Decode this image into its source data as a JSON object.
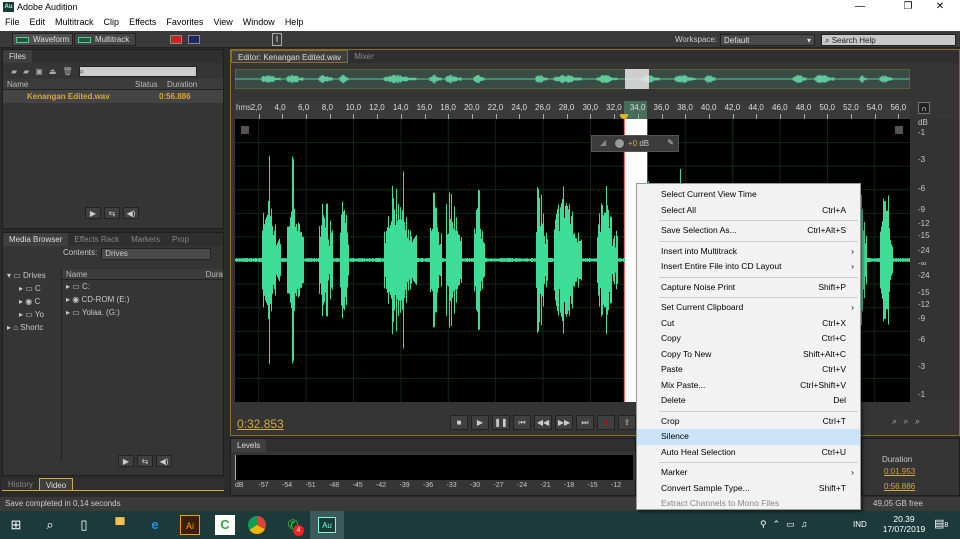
{
  "window": {
    "app_icon": "Au",
    "title": "Adobe Audition",
    "minimize": "—",
    "restore": "❐",
    "close": "✕"
  },
  "menubar": [
    "File",
    "Edit",
    "Multitrack",
    "Clip",
    "Effects",
    "Favorites",
    "View",
    "Window",
    "Help"
  ],
  "toolbar": {
    "waveform": "Waveform",
    "multitrack": "Multitrack",
    "workspace_label": "Workspace:",
    "workspace_value": "Default",
    "search_placeholder": "Search Help"
  },
  "files_panel": {
    "tab": "Files",
    "columns": [
      "Name",
      "Status",
      "Duration"
    ],
    "rows": [
      {
        "name": "Kenangan Edited.wav",
        "status": "",
        "duration": "0:56.886"
      }
    ]
  },
  "media_panel": {
    "tabs": [
      "Media Browser",
      "Effects Rack",
      "Markers",
      "Prop"
    ],
    "contents_label": "Contents:",
    "contents_value": "Drives",
    "tree": [
      "Drives",
      "C",
      "C",
      "Yo",
      "Shortc"
    ],
    "columns": [
      "Name",
      "Dura"
    ],
    "rows": [
      "C:",
      "CD-ROM (E:)",
      "Yolaa. (G:)"
    ]
  },
  "bottom_left_tabs": [
    "History",
    "Video"
  ],
  "editor": {
    "tab": "Editor: Kenangan Edited.wav",
    "mixer_tab": "Mixer",
    "ruler_unit": "hms",
    "ruler_labels": [
      "2,0",
      "4,0",
      "6,0",
      "8,0",
      "10,0",
      "12,0",
      "14,0",
      "16,0",
      "18,0",
      "20,0",
      "22,0",
      "24,0",
      "26,0",
      "28,0",
      "30,0",
      "32,0",
      "34,0",
      "36,0",
      "38,0",
      "40,0",
      "42,0",
      "44,0",
      "46,0",
      "48,0",
      "50,0",
      "52,0",
      "54,0",
      "56,0"
    ],
    "db_labels": [
      "dB",
      "-1",
      "-3",
      "-6",
      "-9",
      "-12",
      "-15",
      "-24",
      "-∞",
      "-24",
      "-15",
      "-12",
      "-9",
      "-6",
      "-3",
      "-1"
    ],
    "hud_value": "+0",
    "hud_unit": "dB",
    "current_time": "0:32.853",
    "duration_s": 56.886,
    "selection_start_s": 32.853,
    "selection_end_s": 34.8
  },
  "transport": [
    "■",
    "▶",
    "❚❚",
    "⏮",
    "◀◀",
    "▶▶",
    "⏭",
    "●",
    "⇪"
  ],
  "levels": {
    "tab": "Levels",
    "scale": [
      "dB",
      "-57",
      "-54",
      "-51",
      "-48",
      "-45",
      "-42",
      "-39",
      "-36",
      "-33",
      "-30",
      "-27",
      "-24",
      "-21",
      "-18",
      "-15",
      "-12"
    ]
  },
  "selection_panel": {
    "duration_header": "Duration",
    "values": [
      "0:01.953",
      "0:56.886"
    ]
  },
  "status": {
    "message": "Save completed in 0,14 seconds",
    "free_space": "49,05 GB free"
  },
  "context_menu": [
    {
      "label": "Select Current View Time",
      "shortcut": ""
    },
    {
      "label": "Select All",
      "shortcut": "Ctrl+A"
    },
    {
      "sep": true
    },
    {
      "label": "Save Selection As...",
      "shortcut": "Ctrl+Alt+S"
    },
    {
      "sep": true
    },
    {
      "label": "Insert into Multitrack",
      "shortcut": "",
      "submenu": true
    },
    {
      "label": "Insert Entire File into CD Layout",
      "shortcut": "",
      "submenu": true
    },
    {
      "sep": true
    },
    {
      "label": "Capture Noise Print",
      "shortcut": "Shift+P"
    },
    {
      "sep": true
    },
    {
      "label": "Set Current Clipboard",
      "shortcut": "",
      "submenu": true
    },
    {
      "label": "Cut",
      "shortcut": "Ctrl+X"
    },
    {
      "label": "Copy",
      "shortcut": "Ctrl+C"
    },
    {
      "label": "Copy To New",
      "shortcut": "Shift+Alt+C"
    },
    {
      "label": "Paste",
      "shortcut": "Ctrl+V"
    },
    {
      "label": "Mix Paste...",
      "shortcut": "Ctrl+Shift+V"
    },
    {
      "label": "Delete",
      "shortcut": "Del"
    },
    {
      "sep": true
    },
    {
      "label": "Crop",
      "shortcut": "Ctrl+T"
    },
    {
      "label": "Silence",
      "shortcut": "",
      "highlighted": true
    },
    {
      "label": "Auto Heal Selection",
      "shortcut": "Ctrl+U"
    },
    {
      "sep": true
    },
    {
      "label": "Marker",
      "shortcut": "",
      "submenu": true
    },
    {
      "label": "Convert Sample Type...",
      "shortcut": "Shift+T"
    },
    {
      "label": "Extract Channels to Mono Files",
      "shortcut": "",
      "disabled": true
    }
  ],
  "taskbar": {
    "icons": [
      "windows-start",
      "search",
      "task-view",
      "file-explorer",
      "edge",
      "illustrator",
      "camtasia",
      "chrome",
      "whatsapp",
      "audition"
    ],
    "whatsapp_badge": "4",
    "lang": "IND",
    "time": "20.39",
    "date": "17/07/2019",
    "notifications": "8"
  },
  "colors": {
    "wave": "#3ddc97",
    "accent": "#d6a93a",
    "bg": "#2b2b2b"
  }
}
